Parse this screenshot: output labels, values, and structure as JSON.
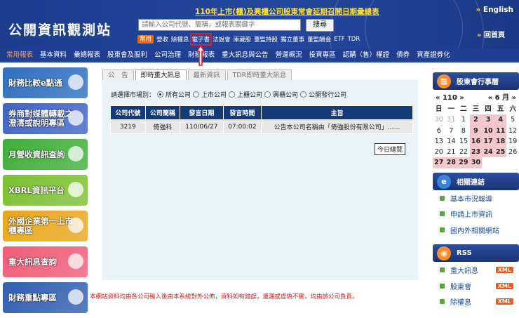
{
  "header": {
    "logo": "公開資訊觀測站",
    "announcement": "110年上市(櫃)及興櫃公司股東常會延期召開日期彙總表",
    "search_placeholder": "請輸入公司代號、簡稱，或報表關鍵字",
    "search_button": "搜尋",
    "english": "English",
    "back_home": "回首頁",
    "quick_tag": "常用",
    "quick_links": [
      "營收",
      "除權息",
      "電子書",
      "法說會",
      "庫藏股",
      "董監持股",
      "獨立董事",
      "董監酬金",
      "ETF",
      "TDR"
    ]
  },
  "nav": [
    "常用報表",
    "基本資料",
    "彙總報表",
    "股東會及股利",
    "公司治理",
    "財務報表",
    "重大訊息與公告",
    "營運概況",
    "投資專區",
    "認購（售）權證",
    "債券",
    "資產證券化"
  ],
  "banners": [
    {
      "text": "財務比較e點通",
      "color": "#2f6fbf"
    },
    {
      "text": "券商對媒體轉載之澄清或說明專區",
      "color": "#3f63c6"
    },
    {
      "text": "月營收資訊查詢",
      "color": "#3fae3a"
    },
    {
      "text": "XBRL資訊平台",
      "color": "#7cc030"
    },
    {
      "text": "外國企業第一上市櫃專區",
      "color": "#e9a61c"
    },
    {
      "text": "重大訊息查詢",
      "color": "#ef5c78"
    },
    {
      "text": "財務重點專區",
      "color": "#2f5fb0"
    }
  ],
  "tabs": [
    "公　告",
    "即時重大訊息",
    "最新資訊",
    "TDR即時重大訊息"
  ],
  "market": {
    "label": "請選擇市場別：",
    "options": [
      "所有公司",
      "上市公司",
      "上櫃公司",
      "興櫃公司",
      "公開發行公司"
    ]
  },
  "table": {
    "headers": [
      "公司代號",
      "公司簡稱",
      "發言日期",
      "發言時間",
      "主旨"
    ],
    "rows": [
      [
        "3219",
        "倚強科",
        "110/06/27",
        "07:00:02",
        "公告本公司名稱由「倚強股份有限公司」……"
      ]
    ]
  },
  "today_button": "今日總覽",
  "disclaimer": "本網站資料均由各公司輸入後由本系統對外公佈，資料如有錯誤，遺漏或虛偽不實，均由該公司負責。",
  "calendar": {
    "title": "股東會行事曆",
    "year": "110",
    "month": "6",
    "weekdays": [
      "日",
      "一",
      "二",
      "三",
      "四",
      "五",
      "六"
    ],
    "days": [
      "30",
      "31",
      "1",
      "2",
      "3",
      "4",
      "5",
      "6",
      "7",
      "8",
      "9",
      "10",
      "11",
      "12",
      "13",
      "14",
      "15",
      "16",
      "17",
      "18",
      "19",
      "20",
      "21",
      "22",
      "23",
      "24",
      "25",
      "26",
      "27",
      "28",
      "29",
      "30"
    ]
  },
  "related": {
    "title": "相關連結",
    "items": [
      "基本市況報導",
      "申請上市資訊",
      "國內外相關網站"
    ]
  },
  "rss": {
    "title": "RSS",
    "items": [
      "重大訊息",
      "股東會",
      "除權息"
    ],
    "badge": "XML"
  }
}
